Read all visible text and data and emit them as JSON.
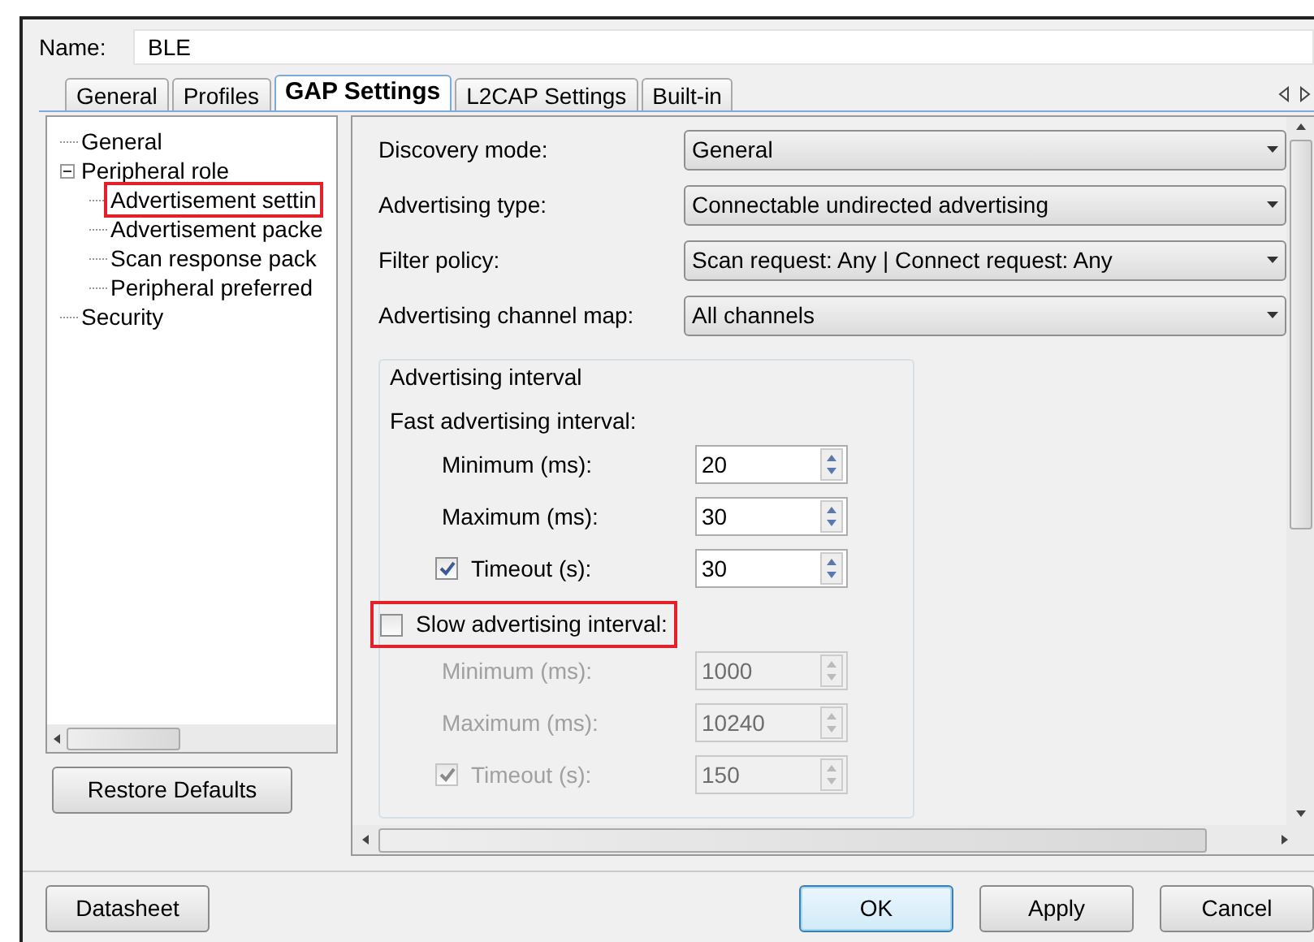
{
  "name_field": {
    "label": "Name:",
    "value": "BLE"
  },
  "tabs": [
    {
      "label": "General",
      "selected": false
    },
    {
      "label": "Profiles",
      "selected": false
    },
    {
      "label": "GAP Settings",
      "selected": true
    },
    {
      "label": "L2CAP Settings",
      "selected": false
    },
    {
      "label": "Built-in",
      "selected": false
    }
  ],
  "tree": [
    {
      "label": "General",
      "annotated": false
    },
    {
      "label": "Peripheral role",
      "annotated": false,
      "expanded": true,
      "children": [
        {
          "label": "Advertisement settin",
          "annotated": true
        },
        {
          "label": "Advertisement packe",
          "annotated": false
        },
        {
          "label": "Scan response pack",
          "annotated": false
        },
        {
          "label": "Peripheral preferred",
          "annotated": false
        }
      ]
    },
    {
      "label": "Security",
      "annotated": false
    }
  ],
  "restore_button": "Restore Defaults",
  "settings": [
    {
      "label": "Discovery mode:",
      "value": "General"
    },
    {
      "label": "Advertising type:",
      "value": "Connectable undirected advertising"
    },
    {
      "label": "Filter policy:",
      "value": "Scan request: Any | Connect request: Any"
    },
    {
      "label": "Advertising channel map:",
      "value": "All channels"
    }
  ],
  "interval_group": {
    "title": "Advertising interval",
    "sections": [
      {
        "kind": "label",
        "label": "Fast advertising interval:",
        "rows": [
          {
            "kind": "spin",
            "label": "Minimum (ms):",
            "value": "20",
            "disabled": false
          },
          {
            "kind": "spin",
            "label": "Maximum (ms):",
            "value": "30",
            "disabled": false
          },
          {
            "kind": "check_spin",
            "label": "Timeout (s):",
            "checked": true,
            "value": "30",
            "disabled": false
          }
        ]
      },
      {
        "kind": "checkbox",
        "label": "Slow advertising interval:",
        "checked": false,
        "annotated": true,
        "rows": [
          {
            "kind": "spin",
            "label": "Minimum (ms):",
            "value": "1000",
            "disabled": true
          },
          {
            "kind": "spin",
            "label": "Maximum (ms):",
            "value": "10240",
            "disabled": true
          },
          {
            "kind": "check_spin",
            "label": "Timeout (s):",
            "checked": true,
            "value": "150",
            "disabled": true
          }
        ]
      }
    ]
  },
  "footer_buttons": [
    {
      "label": "Datasheet",
      "default": false
    },
    {
      "label": "OK",
      "default": true
    },
    {
      "label": "Apply",
      "default": false
    },
    {
      "label": "Cancel",
      "default": false
    }
  ]
}
